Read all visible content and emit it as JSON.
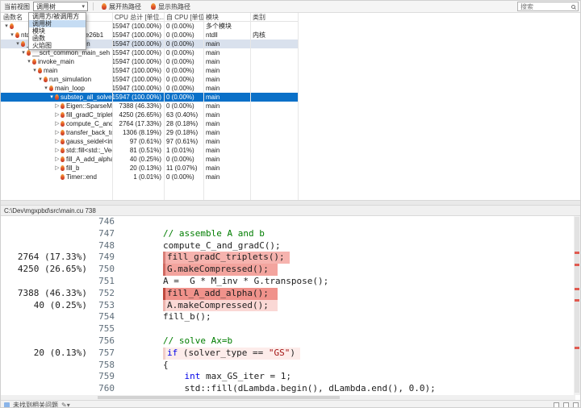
{
  "toolbar": {
    "current_view_label": "当前视图",
    "view_value": "调用树",
    "expand_hot_path_label": "展开热路径",
    "show_hot_path_label": "显示热路径",
    "search_placeholder": "搜索"
  },
  "view_dropdown": {
    "items": [
      {
        "label": "调用方/被调用方",
        "selected": false
      },
      {
        "label": "调用树",
        "selected": true
      },
      {
        "label": "模块",
        "selected": false
      },
      {
        "label": "函数",
        "selected": false
      },
      {
        "label": "火焰图",
        "selected": false
      }
    ]
  },
  "call_tree": {
    "columns": {
      "name": "函数名",
      "total": "CPU 总计 [单位...",
      "self": "自 CPU [单位, %]",
      "module": "模块",
      "category": "类别"
    },
    "rows": [
      {
        "name": "",
        "total": "15947 (100.00%)",
        "self": "0 (0.00%)",
        "module": "多个模块",
        "category": "",
        "indent": 0,
        "expanded": true
      },
      {
        "name": "ntdll.dll!0x00007ffb346e26b1",
        "total": "15947 (100.00%)",
        "self": "0 (0.00%)",
        "module": "ntdll",
        "category": "内核",
        "indent": 1,
        "expanded": true
      },
      {
        "name": "__scrt_common_main",
        "total": "15947 (100.00%)",
        "self": "0 (0.00%)",
        "module": "main",
        "category": "",
        "indent": 2,
        "expanded": true,
        "state": "shaded"
      },
      {
        "name": "__scrt_common_main_seh",
        "total": "15947 (100.00%)",
        "self": "0 (0.00%)",
        "module": "main",
        "category": "",
        "indent": 3,
        "expanded": true
      },
      {
        "name": "invoke_main",
        "total": "15947 (100.00%)",
        "self": "0 (0.00%)",
        "module": "main",
        "category": "",
        "indent": 4,
        "expanded": true
      },
      {
        "name": "main",
        "total": "15947 (100.00%)",
        "self": "0 (0.00%)",
        "module": "main",
        "category": "",
        "indent": 5,
        "expanded": true
      },
      {
        "name": "run_simulation",
        "total": "15947 (100.00%)",
        "self": "0 (0.00%)",
        "module": "main",
        "category": "",
        "indent": 6,
        "expanded": true
      },
      {
        "name": "main_loop",
        "total": "15947 (100.00%)",
        "self": "0 (0.00%)",
        "module": "main",
        "category": "",
        "indent": 7,
        "expanded": true
      },
      {
        "name": "substep_all_solver",
        "total": "15947 (100.00%)",
        "self": "0 (0.00%)",
        "module": "main",
        "category": "",
        "indent": 8,
        "expanded": true,
        "state": "selected"
      },
      {
        "name": "Eigen::SparseMatrix...",
        "total": "7388 (46.33%)",
        "self": "0 (0.00%)",
        "module": "main",
        "category": "",
        "indent": 9,
        "expanded": false
      },
      {
        "name": "fill_gradC_triplets",
        "total": "4250 (26.65%)",
        "self": "63 (0.40%)",
        "module": "main",
        "category": "",
        "indent": 9,
        "expanded": false
      },
      {
        "name": "compute_C_and_gra...",
        "total": "2764 (17.33%)",
        "self": "28 (0.18%)",
        "module": "main",
        "category": "",
        "indent": 9,
        "expanded": false
      },
      {
        "name": "transfer_back_to_pos...",
        "total": "1306 (8.19%)",
        "self": "29 (0.18%)",
        "module": "main",
        "category": "",
        "indent": 9,
        "expanded": false
      },
      {
        "name": "gauss_seidel<int,float,f...",
        "total": "97 (0.61%)",
        "self": "97 (0.61%)",
        "module": "main",
        "category": "",
        "indent": 9,
        "expanded": false
      },
      {
        "name": "std::fill<std::_Vector_ite...",
        "total": "81 (0.51%)",
        "self": "1 (0.01%)",
        "module": "main",
        "category": "",
        "indent": 9,
        "expanded": false
      },
      {
        "name": "fill_A_add_alpha",
        "total": "40 (0.25%)",
        "self": "0 (0.00%)",
        "module": "main",
        "category": "",
        "indent": 9,
        "expanded": false
      },
      {
        "name": "fill_b",
        "total": "20 (0.13%)",
        "self": "11 (0.07%)",
        "module": "main",
        "category": "",
        "indent": 9,
        "expanded": false
      },
      {
        "name": "Timer::end",
        "total": "1 (0.01%)",
        "self": "0 (0.00%)",
        "module": "main",
        "category": "",
        "indent": 9,
        "leaf": true
      }
    ]
  },
  "source_view": {
    "file_path": "C:\\Dev\\mgxpbd\\src\\main.cu 738",
    "lines": [
      {
        "no": "746",
        "gutter": "",
        "indent": 0,
        "segments": []
      },
      {
        "no": "747",
        "gutter": "",
        "indent": 8,
        "segments": [
          {
            "t": "// assemble A and b",
            "c": "comment"
          }
        ]
      },
      {
        "no": "748",
        "gutter": "",
        "indent": 8,
        "segments": [
          {
            "t": "compute_C_and_gradC();",
            "c": "plain"
          }
        ]
      },
      {
        "no": "749",
        "gutter": "2764 (17.33%)",
        "indent": 8,
        "heat_bg": "#f6b3ae",
        "heat_edge": "#d87f78",
        "segments": [
          {
            "t": "fill_gradC_triplets();",
            "c": "plain"
          }
        ]
      },
      {
        "no": "750",
        "gutter": "4250 (26.65%)",
        "indent": 8,
        "heat_bg": "#f3a49e",
        "heat_edge": "#d06a62",
        "segments": [
          {
            "t": "G.makeCompressed();",
            "c": "plain"
          }
        ]
      },
      {
        "no": "751",
        "gutter": "",
        "indent": 8,
        "segments": [
          {
            "t": "A =  G * M_inv * G.transpose();",
            "c": "plain"
          }
        ]
      },
      {
        "no": "752",
        "gutter": "7388 (46.33%)",
        "indent": 8,
        "heat_bg": "#f0928b",
        "heat_edge": "#bf4a3f",
        "segments": [
          {
            "t": "fill_A_add_alpha();",
            "c": "plain"
          }
        ]
      },
      {
        "no": "753",
        "gutter": "40 (0.25%)",
        "indent": 8,
        "heat_bg": "#fad8d5",
        "heat_edge": "#ecb3ad",
        "segments": [
          {
            "t": "A.makeCompressed();",
            "c": "plain"
          }
        ]
      },
      {
        "no": "754",
        "gutter": "",
        "indent": 8,
        "segments": [
          {
            "t": "fill_b();",
            "c": "plain"
          }
        ]
      },
      {
        "no": "755",
        "gutter": "",
        "indent": 0,
        "segments": []
      },
      {
        "no": "756",
        "gutter": "",
        "indent": 8,
        "segments": [
          {
            "t": "// solve Ax=b",
            "c": "comment"
          }
        ]
      },
      {
        "no": "757",
        "gutter": "20 (0.13%)",
        "indent": 8,
        "heat_bg": "#fdecea",
        "heat_edge": "#f2cdc8",
        "segments": [
          {
            "t": "if",
            "c": "keyword"
          },
          {
            "t": " (solver_type == ",
            "c": "plain"
          },
          {
            "t": "\"GS\"",
            "c": "string"
          },
          {
            "t": ")",
            "c": "plain"
          }
        ]
      },
      {
        "no": "758",
        "gutter": "",
        "indent": 8,
        "segments": [
          {
            "t": "{",
            "c": "plain"
          }
        ]
      },
      {
        "no": "759",
        "gutter": "",
        "indent": 12,
        "segments": [
          {
            "t": "int",
            "c": "keyword"
          },
          {
            "t": " max_GS_iter = 1;",
            "c": "plain"
          }
        ]
      },
      {
        "no": "760",
        "gutter": "",
        "indent": 12,
        "segments": [
          {
            "t": "std::fill(dLambda.begin(), dLambda.end(), 0.0);",
            "c": "plain"
          }
        ]
      }
    ]
  },
  "status_bar": {
    "health_text": "未找到相关问题"
  }
}
